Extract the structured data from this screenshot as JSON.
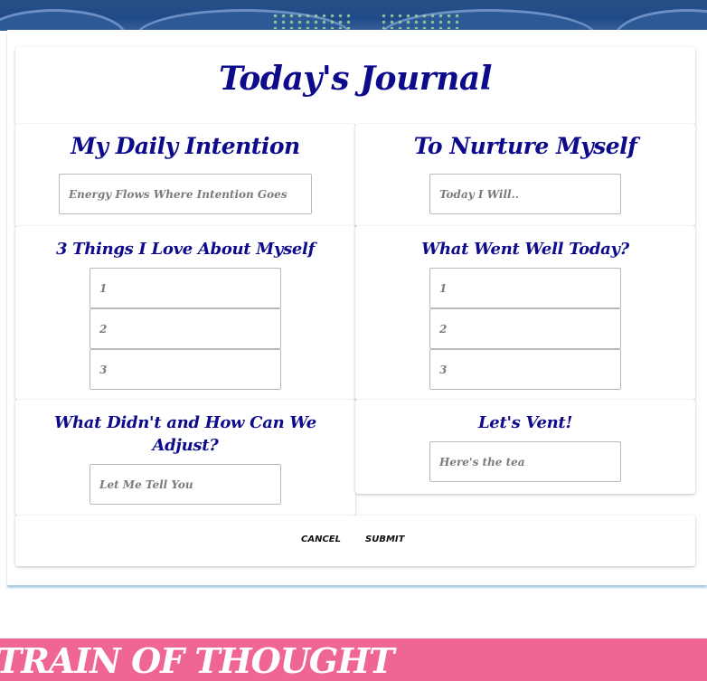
{
  "journal": {
    "title": "Today's Journal",
    "daily_intention": {
      "heading": "My Daily Intention",
      "placeholder": "Energy Flows Where Intention Goes"
    },
    "nurture": {
      "heading": "To Nurture Myself",
      "placeholder": "Today I Will.."
    },
    "love_myself": {
      "heading": "3 Things I Love About Myself",
      "placeholders": [
        "1",
        "2",
        "3"
      ]
    },
    "went_well": {
      "heading": "What Went Well Today?",
      "placeholders": [
        "1",
        "2",
        "3"
      ]
    },
    "adjust": {
      "heading": "What Didn't and How Can We Adjust?",
      "placeholder": "Let Me Tell You"
    },
    "vent": {
      "heading": "Let's Vent!",
      "placeholder": "Here's the tea"
    },
    "actions": {
      "cancel_label": "CANCEL",
      "submit_label": "SUBMIT"
    }
  },
  "footer_banner": {
    "text": "TRAIN OF THOUGHT"
  },
  "colors": {
    "heading": "#0d0b8c",
    "placeholder": "#7b7b7b",
    "banner_pink": "#ef6593",
    "top_banner_blue": "#1f4a88"
  }
}
